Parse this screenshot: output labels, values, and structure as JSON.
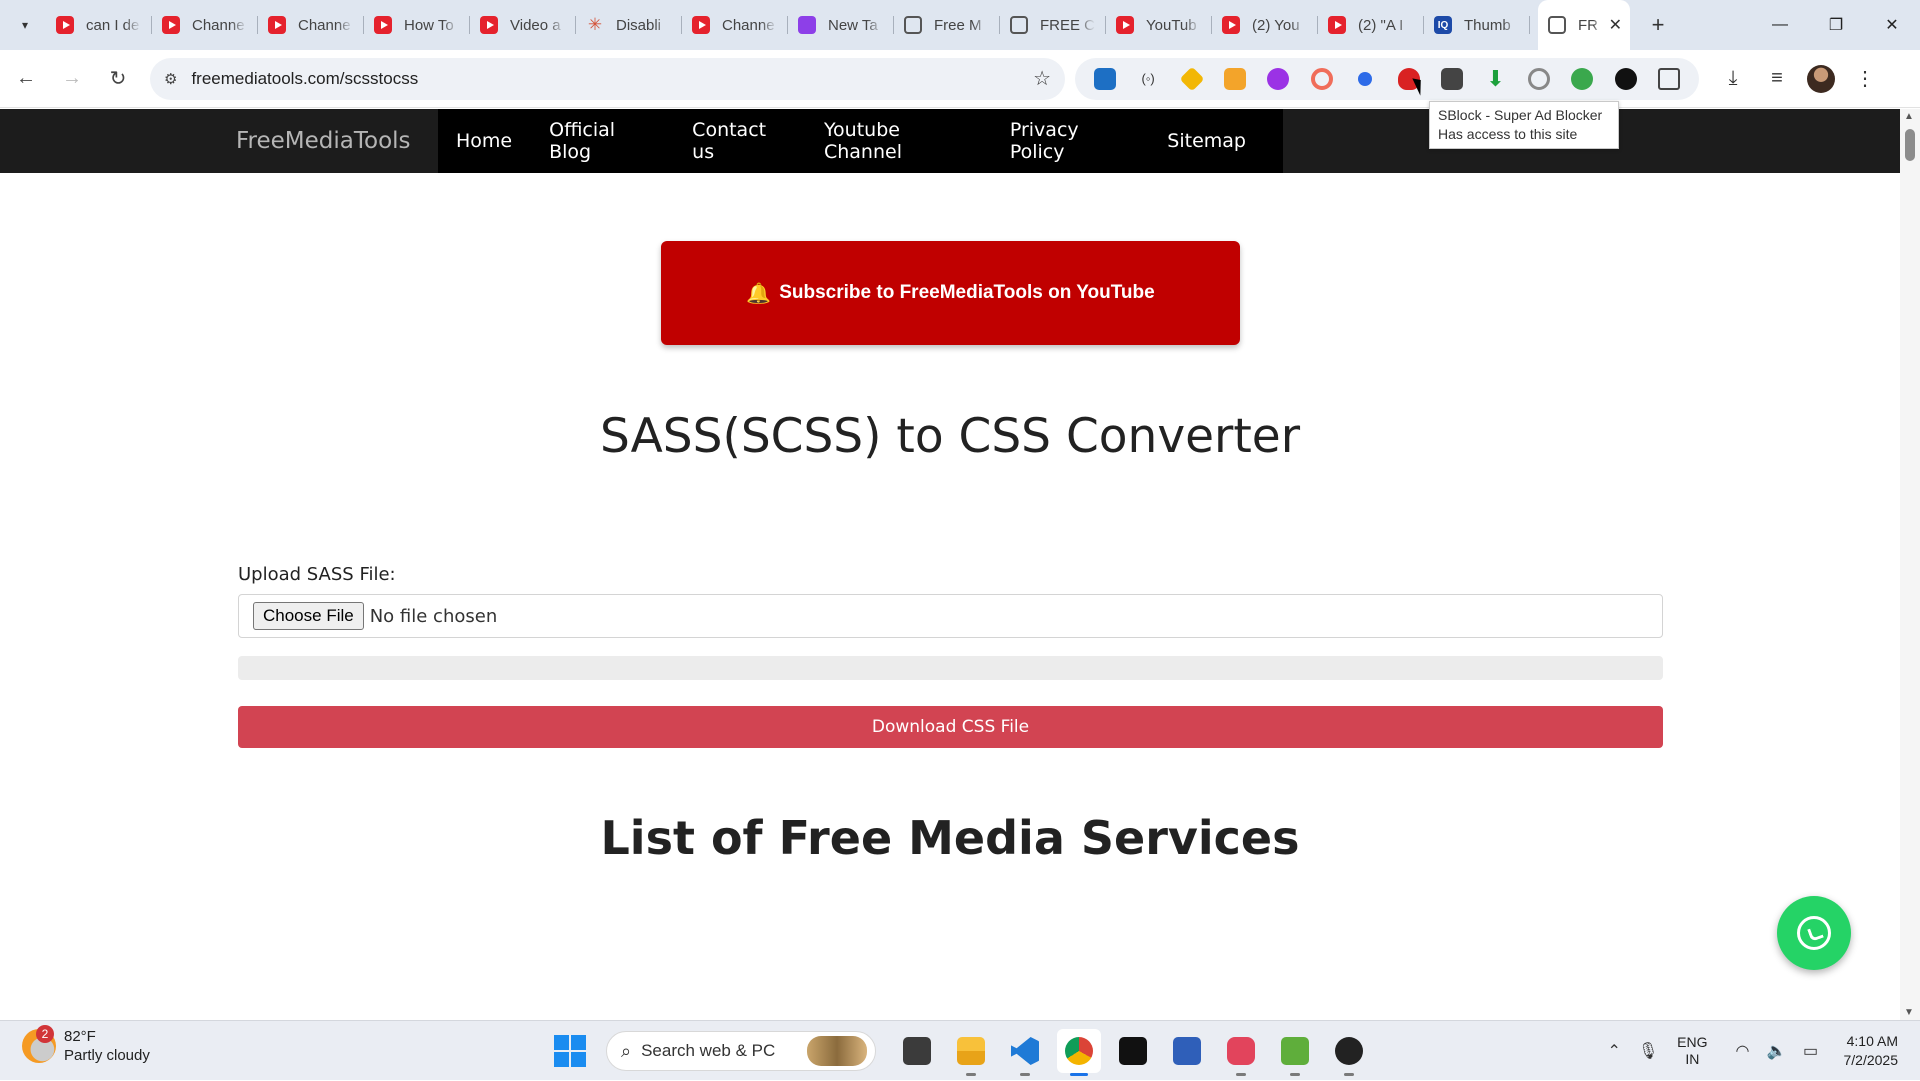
{
  "browser": {
    "tabs": [
      {
        "title": "can I de",
        "favicon": "youtube-icon"
      },
      {
        "title": "Channe",
        "favicon": "youtube-icon"
      },
      {
        "title": "Channe",
        "favicon": "youtube-icon"
      },
      {
        "title": "How To",
        "favicon": "youtube-icon"
      },
      {
        "title": "Video a",
        "favicon": "youtube-icon"
      },
      {
        "title": "Disabli",
        "favicon": "claude-icon"
      },
      {
        "title": "Channe",
        "favicon": "youtube-icon"
      },
      {
        "title": "New Ta",
        "favicon": "purple-app-icon"
      },
      {
        "title": "Free M",
        "favicon": "globe-icon"
      },
      {
        "title": "FREE C",
        "favicon": "globe-icon"
      },
      {
        "title": "YouTub",
        "favicon": "youtube-icon"
      },
      {
        "title": "(2) You",
        "favicon": "youtube-icon"
      },
      {
        "title": "(2) \"A I",
        "favicon": "youtube-icon"
      },
      {
        "title": "Thumb",
        "favicon": "thumbnail-icon"
      }
    ],
    "active_tab": {
      "title": "FR",
      "favicon": "globe-icon",
      "close": "✕"
    },
    "new_tab": "+",
    "window_controls": {
      "minimize": "—",
      "restore": "❐",
      "close": "✕"
    },
    "url": "freemediatools.com/scsstocss",
    "tooltip": {
      "line1": "SBlock - Super Ad Blocker",
      "line2": "Has access to this site"
    }
  },
  "site": {
    "brand": "FreeMediaTools",
    "nav": [
      "Home",
      "Official Blog",
      "Contact us",
      "Youtube Channel",
      "Privacy Policy",
      "Sitemap"
    ],
    "subscribe_label": "Subscribe to FreeMediaTools on YouTube",
    "bell": "🔔",
    "title": "SASS(SCSS) to CSS Converter",
    "upload_label": "Upload SASS File:",
    "choose_file": "Choose File",
    "no_file": "No file chosen",
    "progress": 0,
    "download_label": "Download CSS File",
    "section_title": "List of Free Media Services"
  },
  "taskbar": {
    "weather_badge": "2",
    "temperature": "82°F",
    "condition": "Partly cloudy",
    "search_placeholder": "Search web & PC",
    "lang_line1": "ENG",
    "lang_line2": "IN",
    "time": "4:10 AM",
    "date": "7/2/2025"
  }
}
